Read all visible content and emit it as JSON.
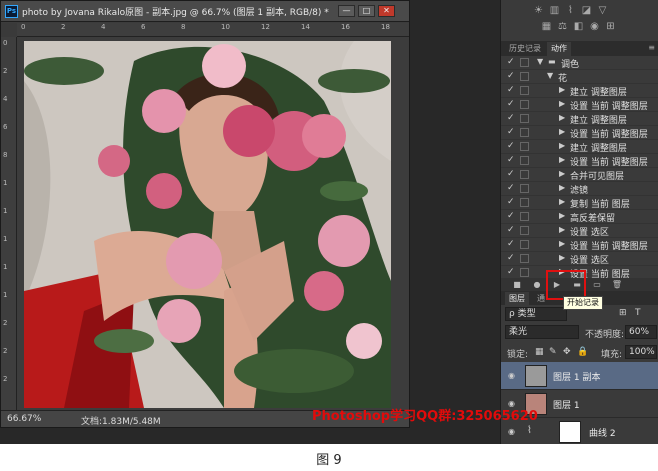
{
  "document": {
    "title": "photo by Jovana Rikalo原图 - 副本.jpg @ 66.7% (图层 1 副本, RGB/8) *",
    "ps_badge": "Ps",
    "window_buttons": [
      "—",
      "□",
      "✕"
    ],
    "ruler_top": [
      "0",
      "2",
      "4",
      "6",
      "8",
      "10",
      "12",
      "14",
      "16",
      "18"
    ],
    "ruler_left": [
      "0",
      "2",
      "4",
      "6",
      "8",
      "1",
      "1",
      "1",
      "1",
      "1",
      "2",
      "2",
      "2"
    ],
    "zoom": "66.67%",
    "info": "文档:1.83M/5.48M"
  },
  "actions_panel": {
    "tabs": [
      "历史记录",
      "动作"
    ],
    "active_tab": "动作",
    "set_name": "调色",
    "action_name": "花",
    "steps": [
      "建立 调整图层",
      "设置 当前 调整图层",
      "建立 调整图层",
      "设置 当前 调整图层",
      "建立 调整图层",
      "设置 当前 调整图层",
      "合并可见图层",
      "滤镜",
      "复制 当前 图层",
      "高反差保留",
      "设置 选区",
      "设置 当前 调整图层",
      "设置 选区",
      "设置 当前 图层"
    ],
    "tooltip": "开始记录"
  },
  "layers_panel": {
    "tabs": [
      "图层",
      "通"
    ],
    "filter_label": "ρ 类型",
    "blend_mode": "柔光",
    "opacity_label": "不透明度:",
    "opacity_value": "60%",
    "lock_label": "锁定:",
    "fill_label": "填充:",
    "fill_value": "100%",
    "layers": [
      {
        "name": "图层 1 副本",
        "thumb": "#9a9a9a",
        "selected": true
      },
      {
        "name": "图层 1",
        "thumb": "#b9847a",
        "selected": false
      },
      {
        "name": "曲线 2",
        "thumb": "#ffffff",
        "selected": false
      }
    ]
  },
  "watermark": "Photoshop学习QQ群:325065620",
  "caption": "图 9",
  "colors": {
    "app_bg": "#282828",
    "panel_bg": "#3a3a3a",
    "selected_row": "#596a85",
    "highlight_red": "#e01010"
  }
}
